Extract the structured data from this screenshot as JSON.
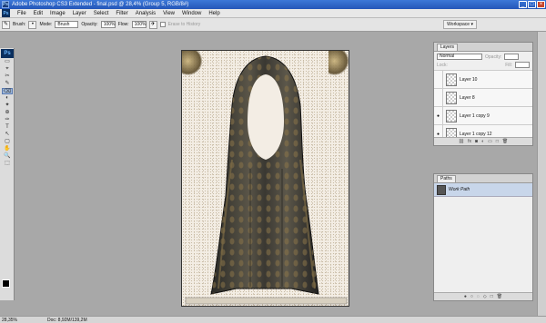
{
  "window": {
    "title": "Adobe Photoshop CS3 Extended - final.psd @ 28,4% (Group 5, RGB/8#)",
    "app_icon": "Ps",
    "controls": [
      "_",
      "□",
      "×"
    ]
  },
  "menu": {
    "logo": "Ps",
    "items": [
      "File",
      "Edit",
      "Image",
      "Layer",
      "Select",
      "Filter",
      "Analysis",
      "View",
      "Window",
      "Help"
    ]
  },
  "options": {
    "brush_label": "Brush:",
    "mode_label": "Mode:",
    "mode_value": "Brush",
    "opacity_label": "Opacity:",
    "opacity_value": "100%",
    "flow_label": "Flow:",
    "flow_value": "100%",
    "erase_history": "Erase to History",
    "workspace": "Workspace ▾"
  },
  "tools": {
    "badge": "Ps",
    "glyphs": [
      "▭",
      "⌖",
      "✂",
      "✎",
      "⌫",
      "◐",
      "✦",
      "⊕",
      "✑",
      "T",
      "↖",
      "▢",
      "✋",
      "🔍",
      "⬚"
    ]
  },
  "status": {
    "zoom": "28,35%",
    "doc": "Doc: 8,92M/139,2M"
  },
  "layers_panel": {
    "tab": "Layers",
    "blend_mode": "Normal",
    "opacity_label": "Opacity:",
    "lock_label": "Lock:",
    "fill_label": "Fill:",
    "layers": [
      {
        "name": "Layer 10",
        "visible": false,
        "selected": false
      },
      {
        "name": "Layer 8",
        "visible": false,
        "selected": false
      },
      {
        "name": "Layer 1 copy 9",
        "visible": true,
        "selected": false
      },
      {
        "name": "Layer 1 copy 12",
        "visible": true,
        "selected": false
      }
    ]
  },
  "paths_panel": {
    "tab": "Paths",
    "paths": [
      {
        "name": "Work Path",
        "selected": true
      }
    ]
  },
  "colors": {
    "title_bar": "#2f66c8",
    "workspace": "#a8a8a8",
    "selected_row": "#c8d6ea"
  }
}
